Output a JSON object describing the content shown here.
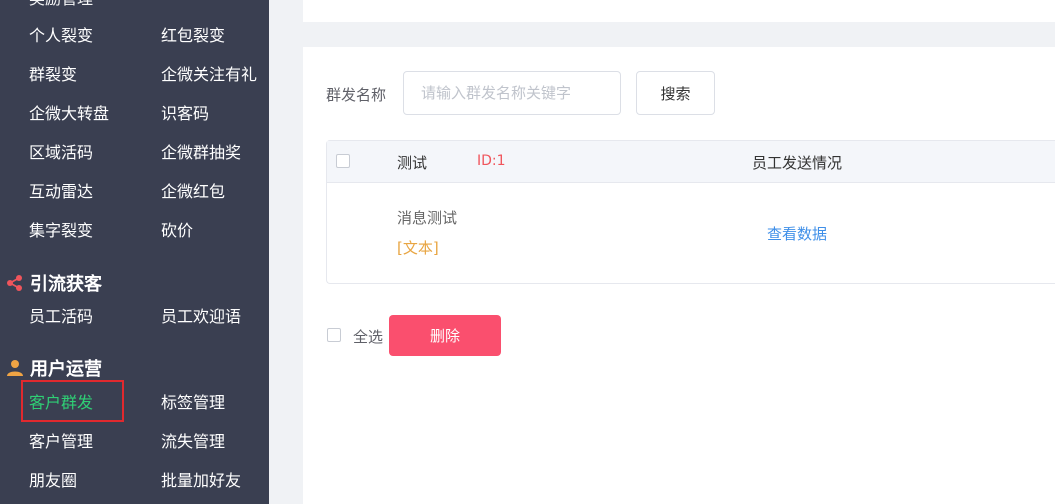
{
  "sidebar": {
    "cut_items": [
      "奖励管理"
    ],
    "rows": [
      [
        "个人裂变",
        "红包裂变"
      ],
      [
        "群裂变",
        "企微关注有礼"
      ],
      [
        "企微大转盘",
        "识客码"
      ],
      [
        "区域活码",
        "企微群抽奖"
      ],
      [
        "互动雷达",
        "企微红包"
      ],
      [
        "集字裂变",
        "砍价"
      ]
    ],
    "section_traffic": {
      "title": "引流获客",
      "icon": "share-icon",
      "items": [
        "员工活码",
        "员工欢迎语"
      ]
    },
    "section_ops": {
      "title": "用户运营",
      "icon": "user-icon",
      "items": [
        [
          "客户群发",
          "标签管理"
        ],
        [
          "客户管理",
          "流失管理"
        ],
        [
          "朋友圈",
          "批量加好友"
        ]
      ],
      "active_item": "客户群发"
    }
  },
  "search": {
    "label": "群发名称",
    "placeholder": "请输入群发名称关键字",
    "button": "搜索"
  },
  "table": {
    "header": {
      "title": "测试",
      "id": "ID:1",
      "status_col": "员工发送情况"
    },
    "row": {
      "name": "消息测试",
      "type": "[文本]",
      "action": "查看数据"
    }
  },
  "footer": {
    "select_all": "全选",
    "delete": "删除"
  },
  "colors": {
    "sidebar_bg": "#3a3f51",
    "active_green": "#2fcf75",
    "delete_red": "#fa4f6e",
    "id_red": "#f0555c",
    "link_blue": "#3f8fe8",
    "tag_orange": "#e8a542"
  }
}
